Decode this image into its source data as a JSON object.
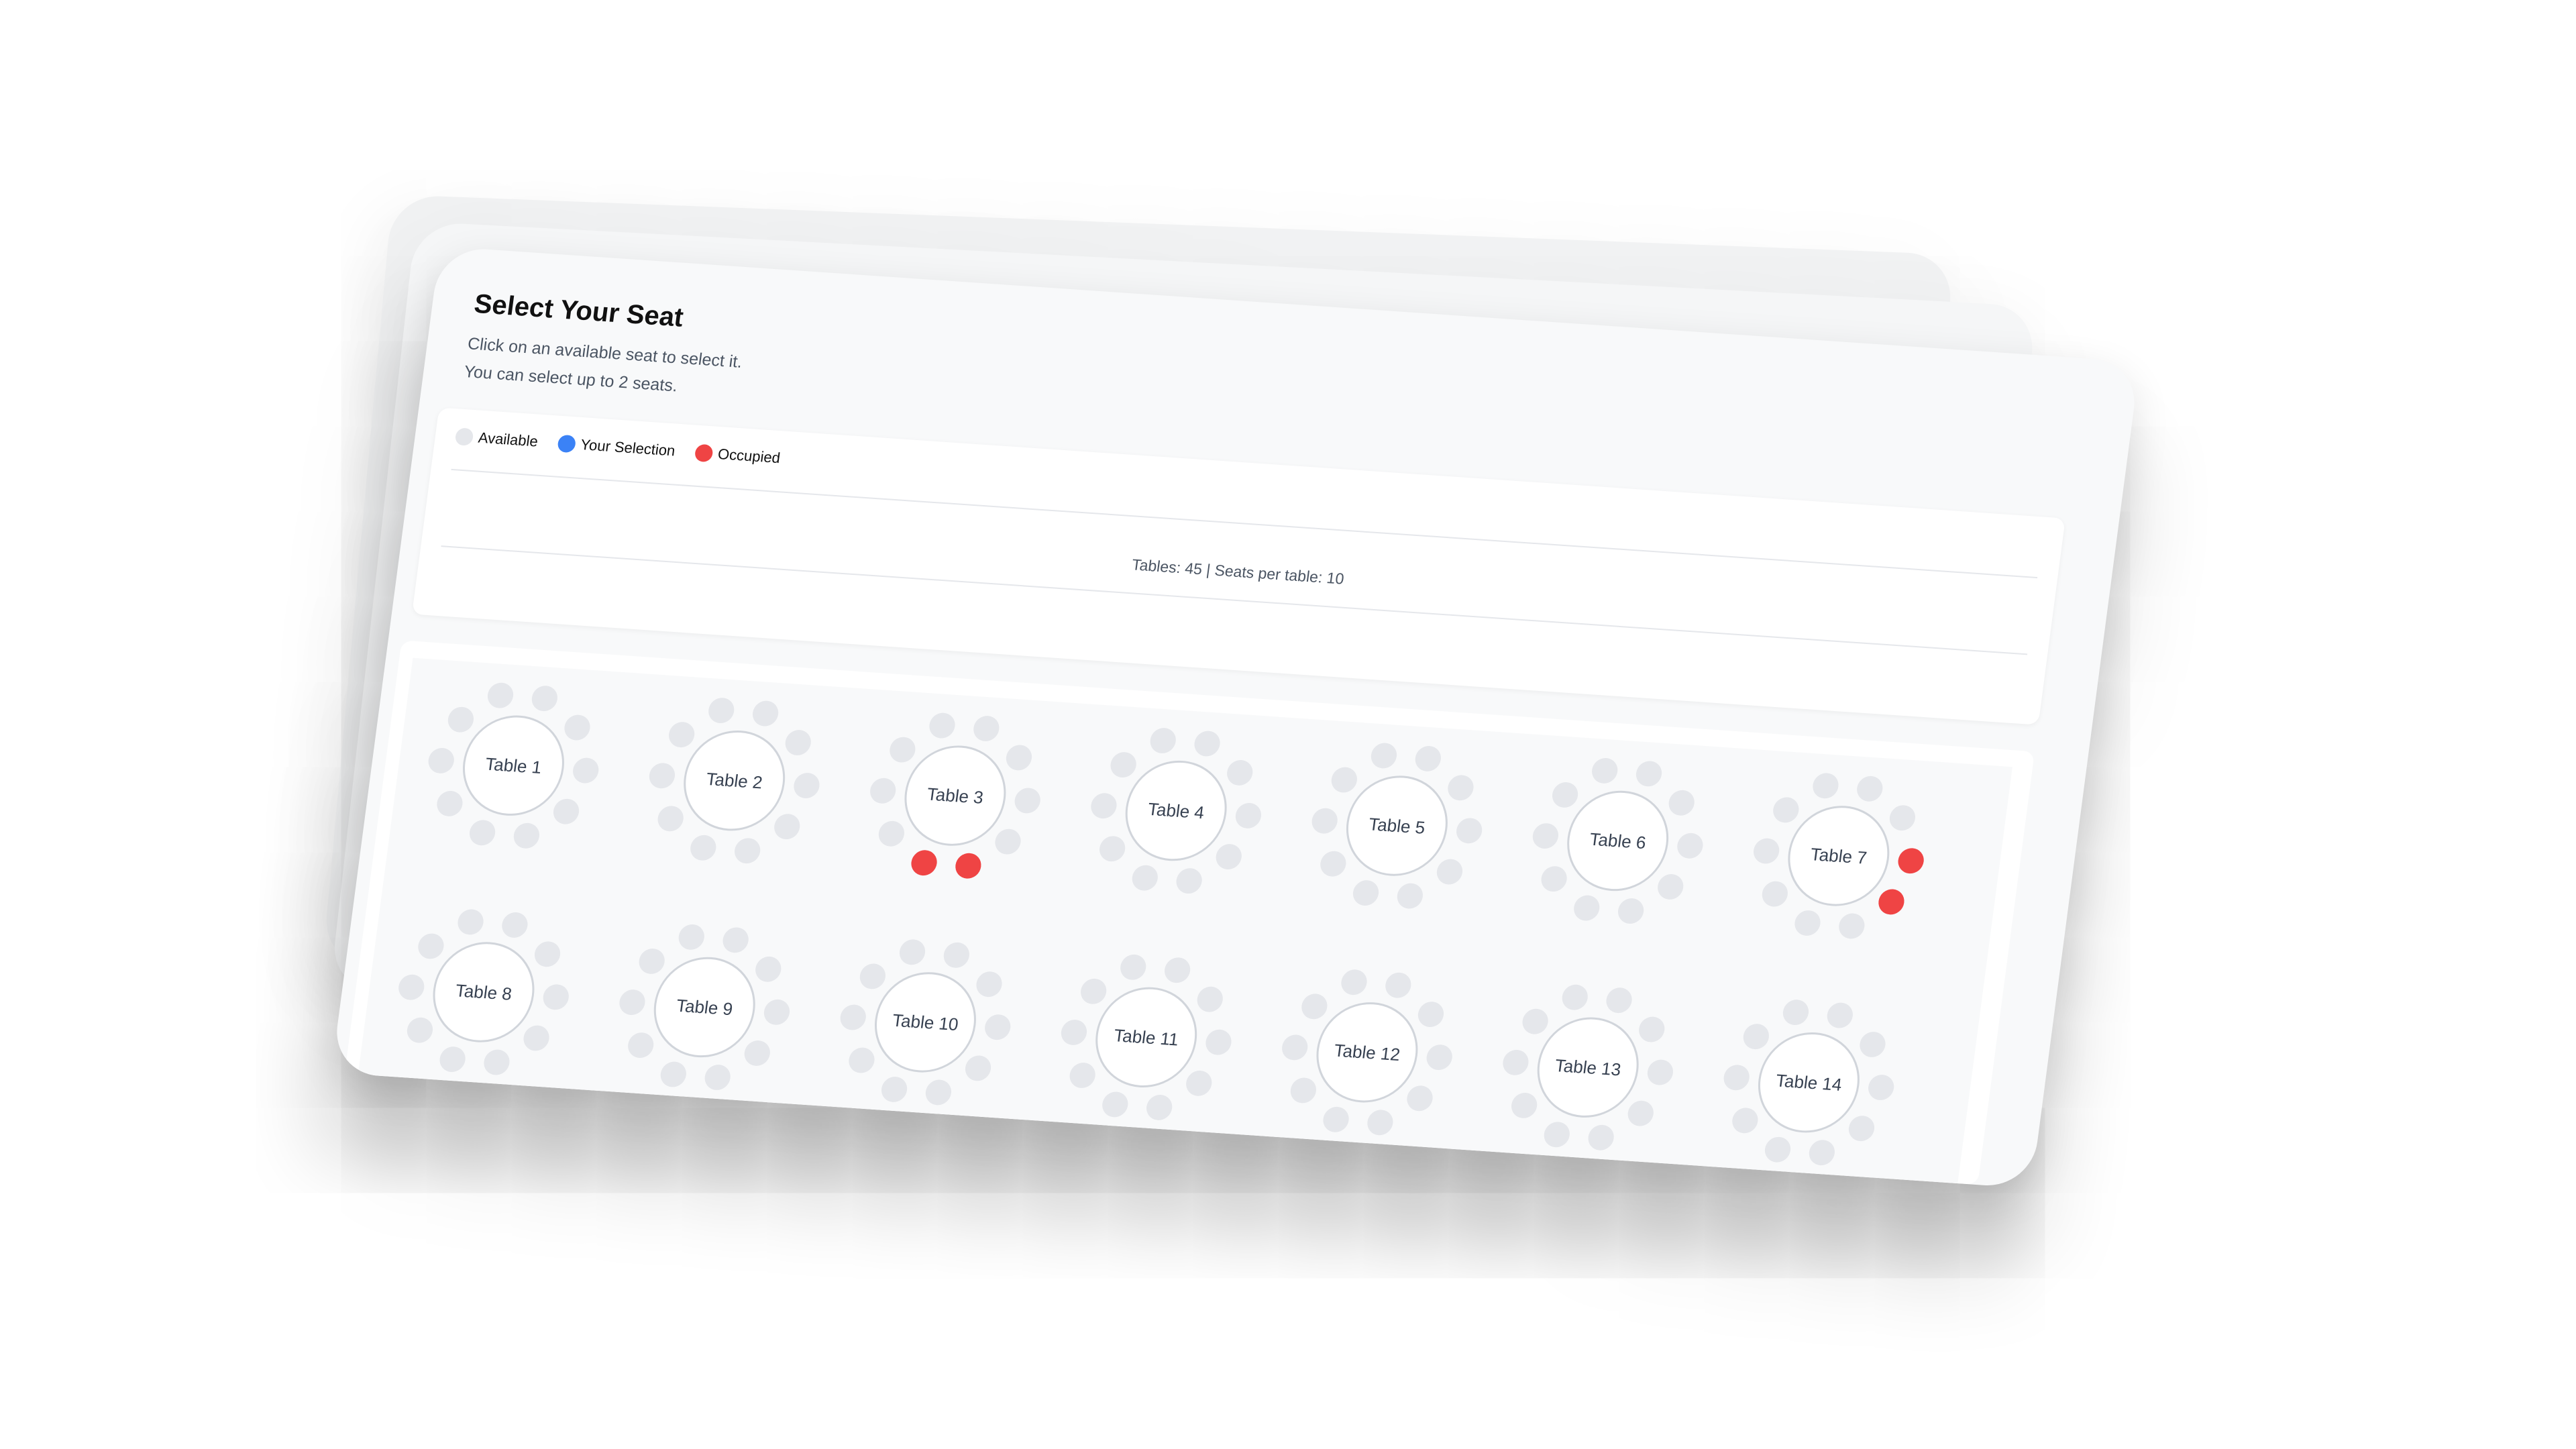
{
  "header": {
    "title": "Select Your Seat",
    "instructions": [
      "Click on an available seat to select it.",
      "You can select up to 2 seats."
    ]
  },
  "legend": [
    {
      "label": "Available",
      "color": "#e5e7eb"
    },
    {
      "label": "Your Selection",
      "color": "#3b82f6"
    },
    {
      "label": "Occupied",
      "color": "#ef4444"
    }
  ],
  "stats": "Tables: 45 | Seats per table: 10",
  "colors": {
    "available": "#e5e7eb",
    "selected": "#3b82f6",
    "occupied": "#ef4444"
  },
  "tables": [
    {
      "name": "Table 1",
      "occupied": []
    },
    {
      "name": "Table 2",
      "occupied": []
    },
    {
      "name": "Table 3",
      "occupied": [
        2,
        3
      ]
    },
    {
      "name": "Table 4",
      "occupied": []
    },
    {
      "name": "Table 5",
      "occupied": []
    },
    {
      "name": "Table 6",
      "occupied": []
    },
    {
      "name": "Table 7",
      "occupied": [
        0,
        1
      ]
    },
    {
      "name": "Table 8",
      "occupied": []
    },
    {
      "name": "Table 9",
      "occupied": []
    },
    {
      "name": "Table 10",
      "occupied": []
    },
    {
      "name": "Table 11",
      "occupied": []
    },
    {
      "name": "Table 12",
      "occupied": []
    },
    {
      "name": "Table 13",
      "occupied": []
    },
    {
      "name": "Table 14",
      "occupied": []
    }
  ]
}
